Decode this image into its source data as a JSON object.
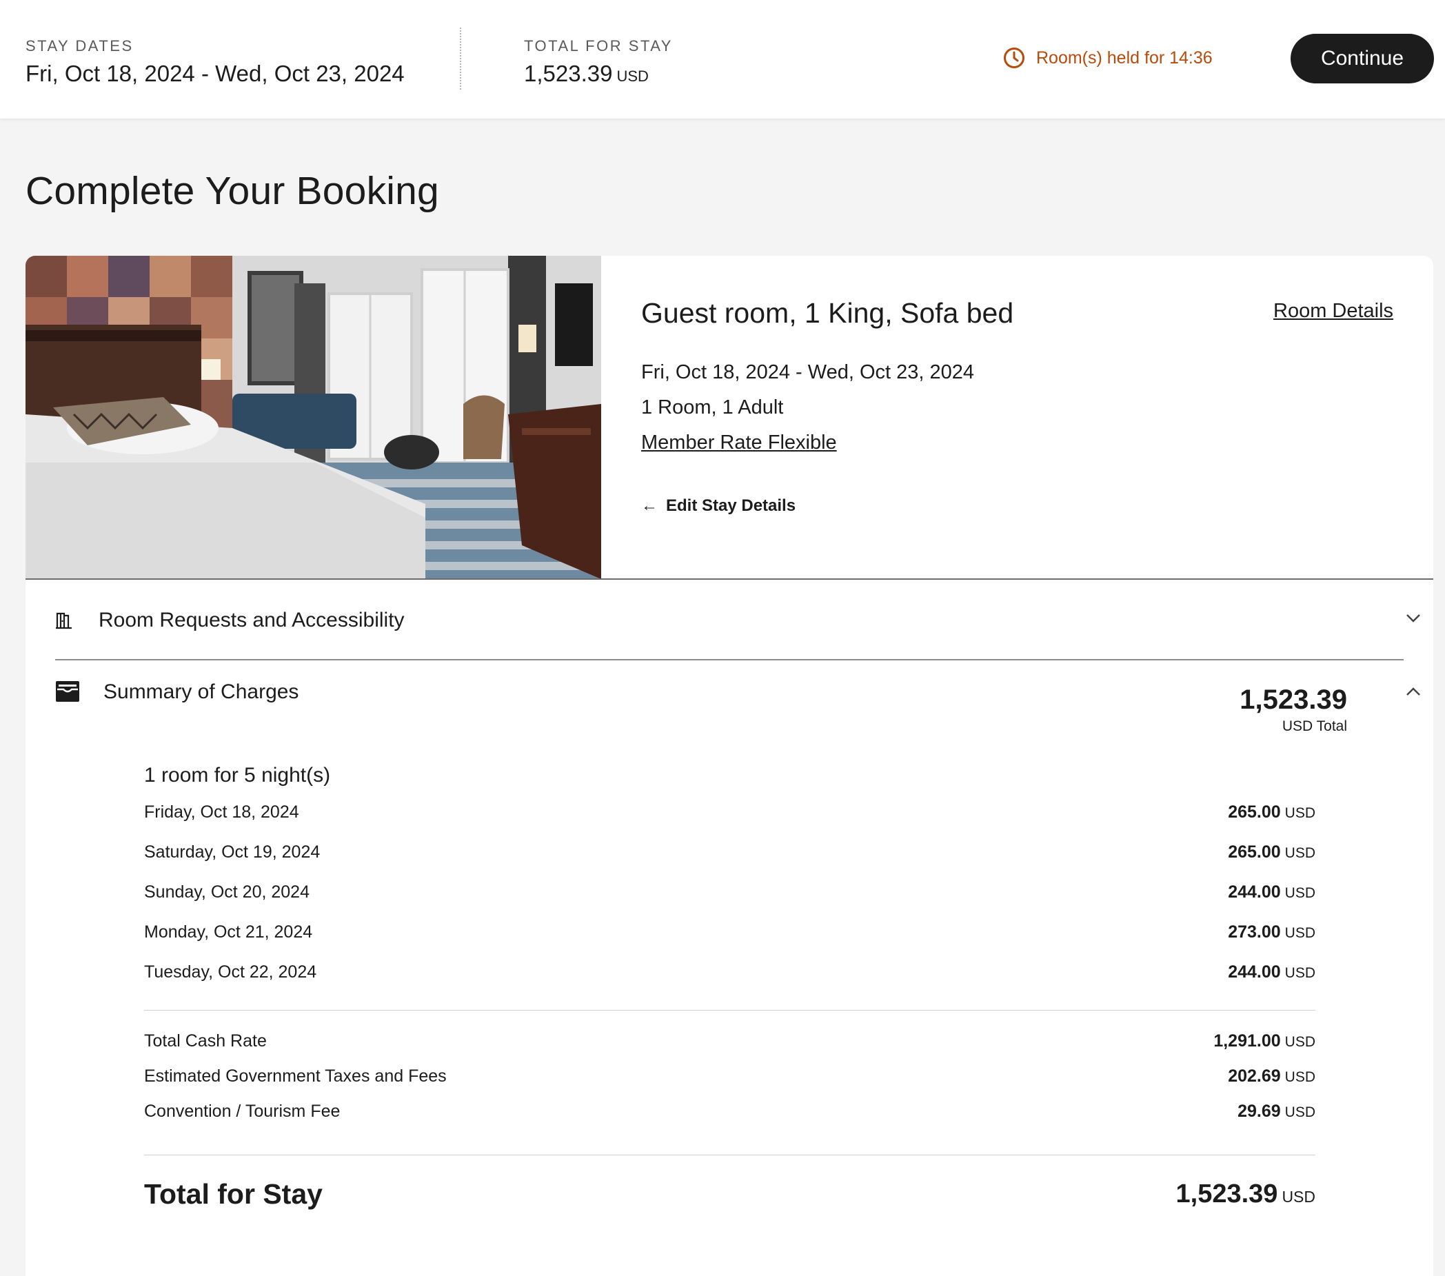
{
  "header": {
    "stay_dates_label": "STAY DATES",
    "stay_dates_value": "Fri, Oct 18, 2024 - Wed, Oct 23, 2024",
    "total_label": "TOTAL FOR STAY",
    "total_value": "1,523.39",
    "total_currency": "USD",
    "hold_text": "Room(s) held for 14:36",
    "continue_label": "Continue"
  },
  "page": {
    "title": "Complete Your Booking"
  },
  "room": {
    "name": "Guest room, 1 King, Sofa bed",
    "details_link": "Room Details",
    "dates": "Fri, Oct 18, 2024 - Wed, Oct 23, 2024",
    "occupancy": "1 Room, 1 Adult",
    "rate_name": "Member Rate Flexible",
    "edit_label": "Edit Stay Details"
  },
  "requests": {
    "title": "Room Requests and Accessibility"
  },
  "summary": {
    "title": "Summary of Charges",
    "total": "1,523.39",
    "total_label": "USD Total",
    "stay_heading": "1 room for 5 night(s)",
    "nights": [
      {
        "date": "Friday, Oct 18, 2024",
        "amount": "265.00",
        "currency": "USD"
      },
      {
        "date": "Saturday, Oct 19, 2024",
        "amount": "265.00",
        "currency": "USD"
      },
      {
        "date": "Sunday, Oct 20, 2024",
        "amount": "244.00",
        "currency": "USD"
      },
      {
        "date": "Monday, Oct 21, 2024",
        "amount": "273.00",
        "currency": "USD"
      },
      {
        "date": "Tuesday, Oct 22, 2024",
        "amount": "244.00",
        "currency": "USD"
      }
    ],
    "fees": [
      {
        "label": "Total Cash Rate",
        "amount": "1,291.00",
        "currency": "USD"
      },
      {
        "label": "Estimated Government Taxes and Fees",
        "amount": "202.69",
        "currency": "USD"
      },
      {
        "label": "Convention / Tourism Fee",
        "amount": "29.69",
        "currency": "USD"
      }
    ],
    "grand_label": "Total for Stay",
    "grand_amount": "1,523.39",
    "grand_currency": "USD"
  },
  "colors": {
    "accent_dark": "#1c1c1c",
    "hold_orange": "#b94a0a",
    "page_bg": "#f4f4f4"
  }
}
